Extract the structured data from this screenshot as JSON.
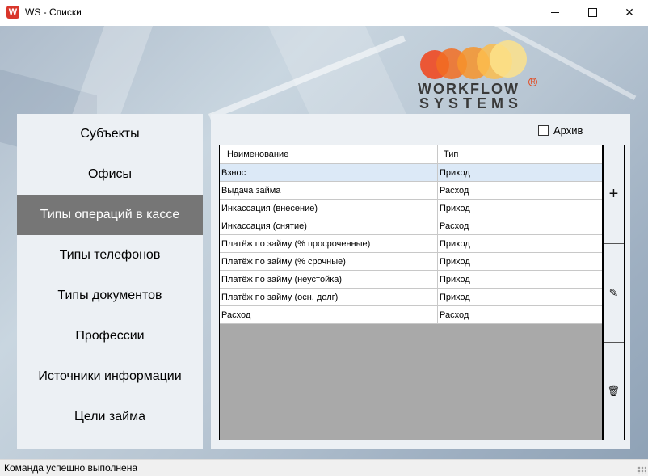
{
  "window": {
    "app_icon_letter": "W",
    "title": "WS - Списки",
    "minimize": "—",
    "maximize": "☐",
    "close": "✕"
  },
  "logo": {
    "line1": "WORKFLOW",
    "line2": "SYSTEMS",
    "reg_mark": "R",
    "colors": [
      "#f04a22",
      "#f26d22",
      "#f7942b",
      "#fbbd4d",
      "#fde28b"
    ]
  },
  "sidebar": {
    "items": [
      {
        "label": "Субъекты",
        "active": false
      },
      {
        "label": "Офисы",
        "active": false
      },
      {
        "label": "Типы операций в кассе",
        "active": true
      },
      {
        "label": "Типы телефонов",
        "active": false
      },
      {
        "label": "Типы документов",
        "active": false
      },
      {
        "label": "Профессии",
        "active": false
      },
      {
        "label": "Источники информации",
        "active": false
      },
      {
        "label": "Цели займа",
        "active": false
      }
    ]
  },
  "panel": {
    "archive_label": "Архив",
    "archive_checked": false,
    "table": {
      "columns": [
        "Наименование",
        "Тип"
      ],
      "rows": [
        [
          "Взнос",
          "Приход"
        ],
        [
          "Выдача займа",
          "Расход"
        ],
        [
          "Инкассация (внесение)",
          "Приход"
        ],
        [
          "Инкассация (снятие)",
          "Расход"
        ],
        [
          "Платёж по займу (% просроченные)",
          "Приход"
        ],
        [
          "Платёж по займу (% срочные)",
          "Приход"
        ],
        [
          "Платёж по займу (неустойка)",
          "Приход"
        ],
        [
          "Платёж по займу (осн. долг)",
          "Приход"
        ],
        [
          "Расход",
          "Расход"
        ]
      ],
      "selected_row": 0
    },
    "toolbar": {
      "add": "+",
      "edit": "✎",
      "delete": "🗑"
    }
  },
  "status": {
    "text": "Команда успешно выполнена"
  },
  "colors": {
    "sidebar_active_bg": "#767676",
    "selected_row_bg": "#dce9f7",
    "grid_empty_bg": "#a9a9a9"
  }
}
